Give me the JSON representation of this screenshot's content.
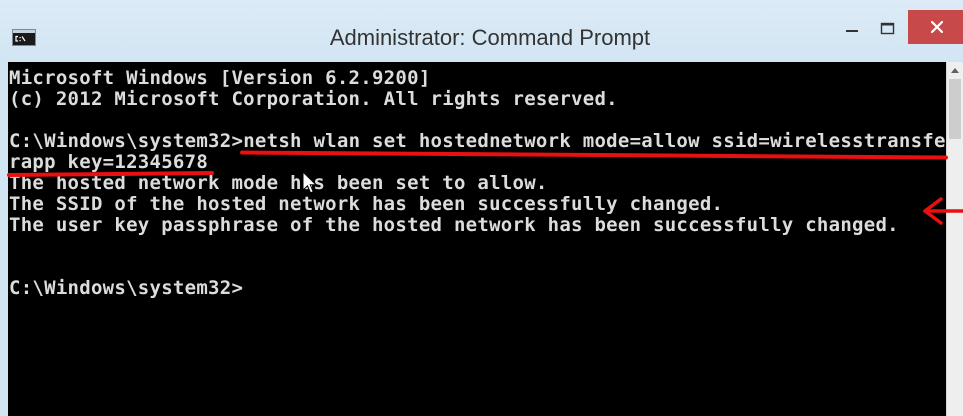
{
  "window": {
    "title": "Administrator: Command Prompt",
    "app_icon": "cmd-icon",
    "controls": {
      "minimize": "minimize-icon",
      "maximize": "maximize-icon",
      "close": "close-icon"
    }
  },
  "console": {
    "banner": [
      "Microsoft Windows [Version 6.2.9200]",
      "(c) 2012 Microsoft Corporation. All rights reserved."
    ],
    "prompt": "C:\\Windows\\system32>",
    "command_lines": [
      "netsh wlan set hostednetwork mode=allow ssid=wirelesstransfe",
      "rapp key=12345678"
    ],
    "output": [
      "The hosted network mode has been set to allow.",
      "The SSID of the hosted network has been successfully changed.",
      "The user key passphrase of the hosted network has been successfully changed."
    ]
  },
  "scrollbar": {
    "position": 0,
    "up_icon": "scroll-up-arrow-icon"
  },
  "overlay": {
    "cursor_icon": "mouse-pointer-icon",
    "arrow_icon": "annotation-arrow-left-icon"
  },
  "colors": {
    "frame": "#d2e5f3",
    "title_text": "#333333",
    "close_button": "#c74949",
    "console_bg": "#000000",
    "console_text": "#dcdcdc",
    "scrollbar_track": "#eeeeee",
    "scrollbar_thumb": "#cdcdcd",
    "annotation": "#e81010"
  }
}
